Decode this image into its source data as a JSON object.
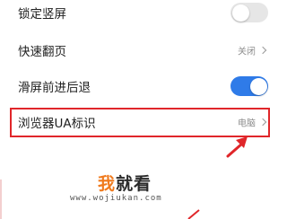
{
  "settings": {
    "items": [
      {
        "label": "锁定竖屏",
        "type": "toggle",
        "state": "off"
      },
      {
        "label": "快速翻页",
        "type": "value",
        "value": "关闭"
      },
      {
        "label": "滑屏前进后退",
        "type": "toggle",
        "state": "on"
      },
      {
        "label": "浏览器UA标识",
        "type": "value",
        "value": "电脑"
      }
    ]
  },
  "colors": {
    "toggle_on": "#2f7be8",
    "toggle_off": "#e6e6e6",
    "highlight": "#e0262a",
    "watermark_accent": "#f07a1d"
  },
  "watermark": {
    "logo_first_char": "我",
    "logo_rest": "就看",
    "url": "www.wojiukan.com"
  },
  "icons": {
    "chevron": "chevron-right-icon",
    "annotation_arrow": "red-arrow-icon"
  }
}
